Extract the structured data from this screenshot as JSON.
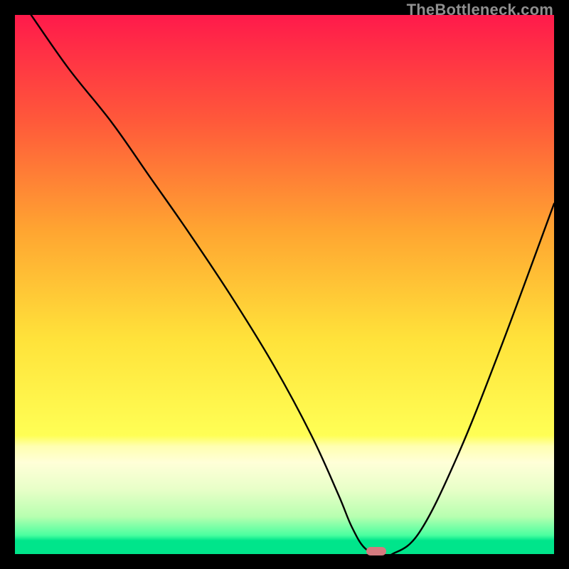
{
  "watermark": "TheBottleneck.com",
  "chart_data": {
    "type": "line",
    "title": "",
    "xlabel": "",
    "ylabel": "",
    "xlim": [
      0,
      100
    ],
    "ylim": [
      0,
      100
    ],
    "grid": false,
    "legend": false,
    "gradient_stops": [
      {
        "offset": 0.0,
        "color": "#ff1a4b"
      },
      {
        "offset": 0.2,
        "color": "#ff5a3a"
      },
      {
        "offset": 0.4,
        "color": "#ffa531"
      },
      {
        "offset": 0.6,
        "color": "#ffe23a"
      },
      {
        "offset": 0.78,
        "color": "#ffff55"
      },
      {
        "offset": 0.8,
        "color": "#ffffb0"
      },
      {
        "offset": 0.83,
        "color": "#ffffd8"
      },
      {
        "offset": 0.88,
        "color": "#e8ffc8"
      },
      {
        "offset": 0.93,
        "color": "#b8ffb0"
      },
      {
        "offset": 0.965,
        "color": "#4bffa0"
      },
      {
        "offset": 0.975,
        "color": "#00e58b"
      },
      {
        "offset": 1.0,
        "color": "#00e58b"
      }
    ],
    "series": [
      {
        "name": "bottleneck-curve",
        "x": [
          3,
          10,
          18,
          25,
          32,
          40,
          48,
          55,
          60,
          62.5,
          65,
          68,
          70,
          75,
          82,
          90,
          100
        ],
        "y": [
          100,
          90,
          80,
          70,
          60,
          48,
          35,
          22,
          11,
          5,
          1,
          0,
          0,
          4,
          18,
          38,
          65
        ]
      }
    ],
    "marker": {
      "x": 67,
      "y": 0.5,
      "color": "#d47a7f"
    }
  }
}
